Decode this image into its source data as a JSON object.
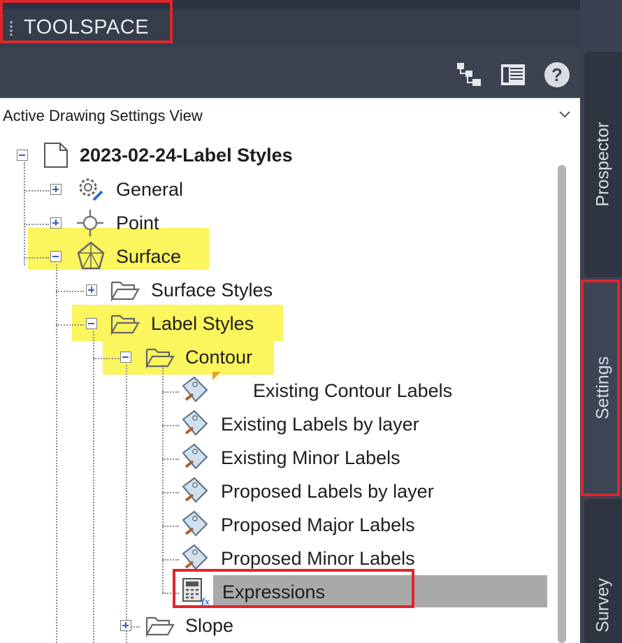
{
  "titlebar": {
    "title": "TOOLSPACE"
  },
  "toolbar": {
    "icons": [
      "tree-view-icon",
      "item-view-icon",
      "help-icon"
    ],
    "help_glyph": "?"
  },
  "view_selector": {
    "value": "Active Drawing Settings View"
  },
  "tree": {
    "root": "2023-02-24-Label Styles",
    "general": "General",
    "point": "Point",
    "surface": "Surface",
    "surface_styles": "Surface Styles",
    "label_styles": "Label Styles",
    "contour": "Contour",
    "contour_items": [
      "Existing Contour Labels",
      "Existing Labels by layer",
      "Existing Minor Labels",
      "Proposed Labels by layer",
      "Proposed Major Labels",
      "Proposed Minor Labels"
    ],
    "expressions": "Expressions",
    "slope": "Slope"
  },
  "side_tabs": {
    "prospector": "Prospector",
    "settings": "Settings",
    "survey": "Survey"
  },
  "colors": {
    "highlight": "#fbf55e",
    "annotation_red": "#e0262b",
    "selection": "#a9a9a9",
    "panel_dark": "#353c4a"
  }
}
